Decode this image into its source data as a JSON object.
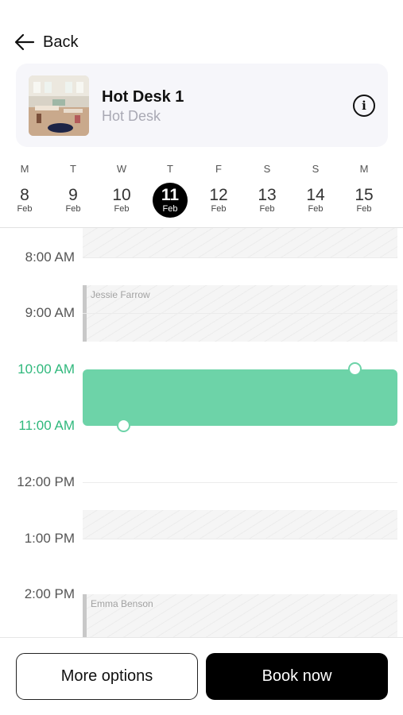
{
  "nav": {
    "back_label": "Back"
  },
  "resource": {
    "title": "Hot Desk 1",
    "subtitle": "Hot Desk",
    "thumbnail_icon": "room-photo",
    "info_icon": "info-icon"
  },
  "days": [
    {
      "weekday": "M",
      "day": "8",
      "month": "Feb",
      "selected": false
    },
    {
      "weekday": "T",
      "day": "9",
      "month": "Feb",
      "selected": false
    },
    {
      "weekday": "W",
      "day": "10",
      "month": "Feb",
      "selected": false
    },
    {
      "weekday": "T",
      "day": "11",
      "month": "Feb",
      "selected": true
    },
    {
      "weekday": "F",
      "day": "12",
      "month": "Feb",
      "selected": false
    },
    {
      "weekday": "S",
      "day": "13",
      "month": "Feb",
      "selected": false
    },
    {
      "weekday": "S",
      "day": "14",
      "month": "Feb",
      "selected": false
    },
    {
      "weekday": "M",
      "day": "15",
      "month": "Feb",
      "selected": false
    }
  ],
  "timeline": {
    "hours": [
      "8:00 AM",
      "9:00 AM",
      "10:00 AM",
      "11:00 AM",
      "12:00 PM",
      "1:00 PM",
      "2:00 PM"
    ],
    "selected_start": "10:00 AM",
    "selected_end": "11:00 AM",
    "bookings": [
      {
        "name": "Jessie Farrow"
      },
      {
        "name": "Emma Benson"
      }
    ]
  },
  "colors": {
    "accent": "#6dd3a8",
    "accent_text": "#2fb87c",
    "selected_day_bg": "#000000"
  },
  "actions": {
    "more_options_label": "More options",
    "book_now_label": "Book now"
  }
}
